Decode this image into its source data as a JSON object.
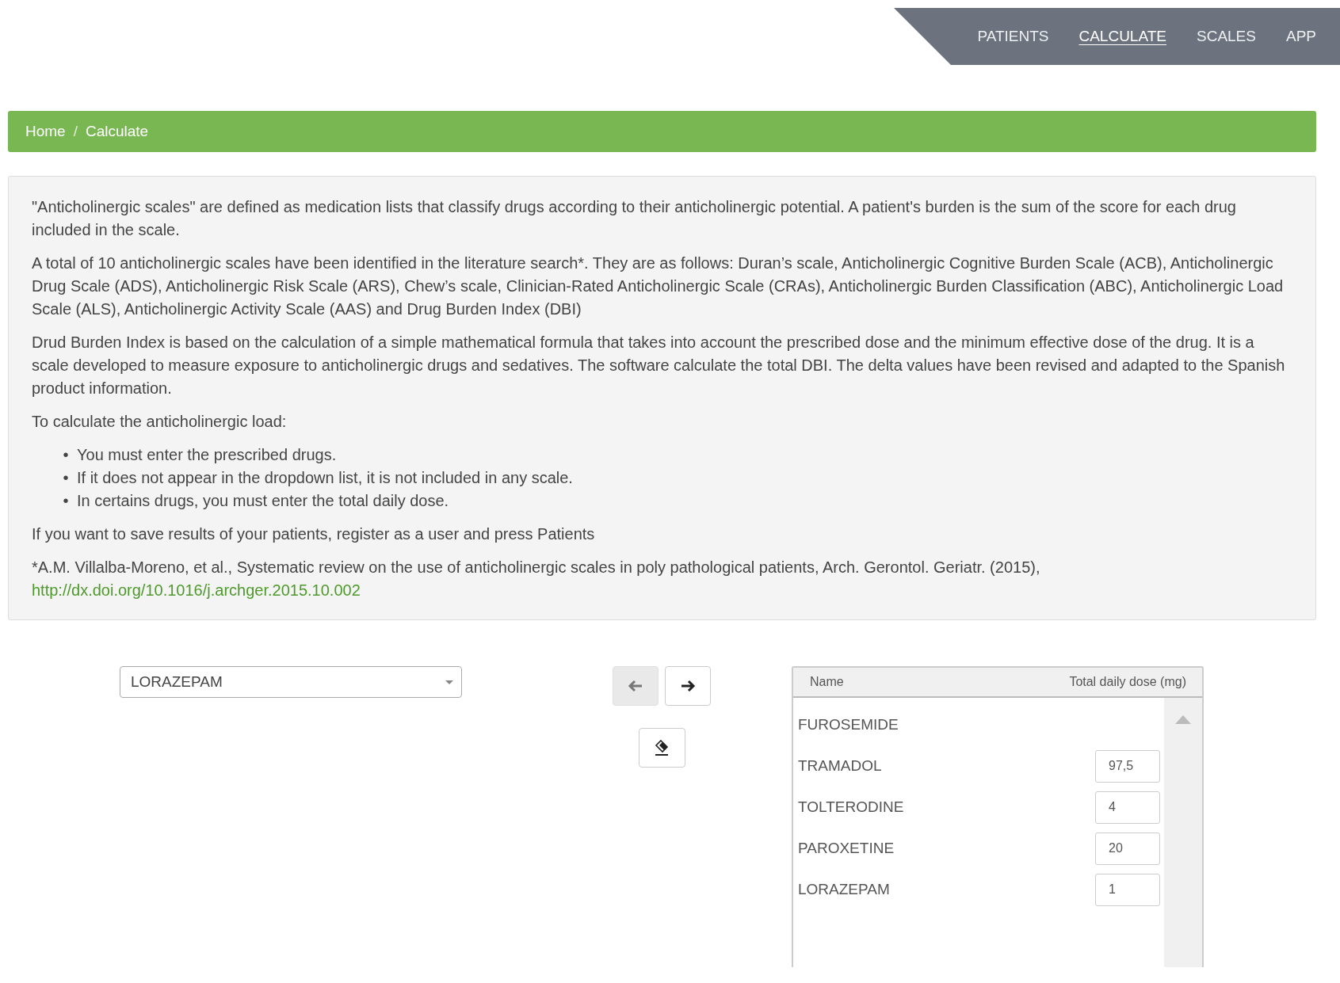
{
  "nav": {
    "items": [
      {
        "label": "PATIENTS",
        "selected": false
      },
      {
        "label": "CALCULATE",
        "selected": true
      },
      {
        "label": "SCALES",
        "selected": false
      },
      {
        "label": "APP",
        "selected": false
      }
    ]
  },
  "breadcrumb": {
    "separator": "/",
    "items": [
      {
        "label": "Home"
      },
      {
        "label": "Calculate"
      }
    ]
  },
  "info": {
    "blocks": [
      {
        "kind": "paragraph",
        "text": "\"Anticholinergic scales\" are defined as medication lists that classify drugs according to their anticholinergic potential. A patient's burden is the sum of the score for each drug included in the scale."
      },
      {
        "kind": "paragraph",
        "text": "A total of 10 anticholinergic scales have been identified in the literature search*. They are as follows: Duran’s scale, Anticholinergic Cognitive Burden Scale (ACB), Anticholinergic Drug Scale (ADS), Anticholinergic Risk Scale (ARS), Chew’s scale, Clinician-Rated Anticholinergic Scale (CRAs), Anticholinergic Burden Classification (ABC), Anticholinergic Load Scale (ALS), Anticholinergic Activity Scale (AAS) and Drug Burden Index (DBI)"
      },
      {
        "kind": "paragraph",
        "text": "Drud Burden Index is based on the calculation of a simple mathematical formula that takes into account the prescribed dose and the minimum effective dose of the drug. It is a scale developed to measure exposure to anticholinergic drugs and sedatives. The software calculate the total DBI. The delta values have been revised and adapted to the Spanish product information."
      },
      {
        "kind": "paragraph",
        "text": "To calculate the anticholinergic load:"
      },
      {
        "kind": "list",
        "marker": "•",
        "items": [
          "You must enter the prescribed drugs.",
          "If it does not appear in the dropdown list, it is not included in any scale.",
          "In certains drugs, you must enter the total daily dose."
        ]
      },
      {
        "kind": "paragraph",
        "text": "If you want to save results of your patients, register as a user and press Patients"
      },
      {
        "kind": "reference",
        "text": "*A.M. Villalba-Moreno, et al., Systematic review on the use of anticholinergic scales in poly pathological patients, Arch. Gerontol. Geriatr. (2015),",
        "link": "http://dx.doi.org/10.1016/j.archger.2015.10.002"
      }
    ]
  },
  "drug_select": {
    "value": "LORAZEPAM"
  },
  "move_buttons": [
    {
      "kind": "left",
      "disabled": true
    },
    {
      "kind": "right",
      "disabled": false
    }
  ],
  "table": {
    "columns": [
      "Name",
      "Total daily dose (mg)"
    ],
    "rows": [
      {
        "name": "FUROSEMIDE"
      },
      {
        "name": "TRAMADOL",
        "dose": "97,5"
      },
      {
        "name": "TOLTERODINE",
        "dose": "4"
      },
      {
        "name": "PAROXETINE",
        "dose": "20"
      },
      {
        "name": "LORAZEPAM",
        "dose": "1"
      }
    ]
  }
}
